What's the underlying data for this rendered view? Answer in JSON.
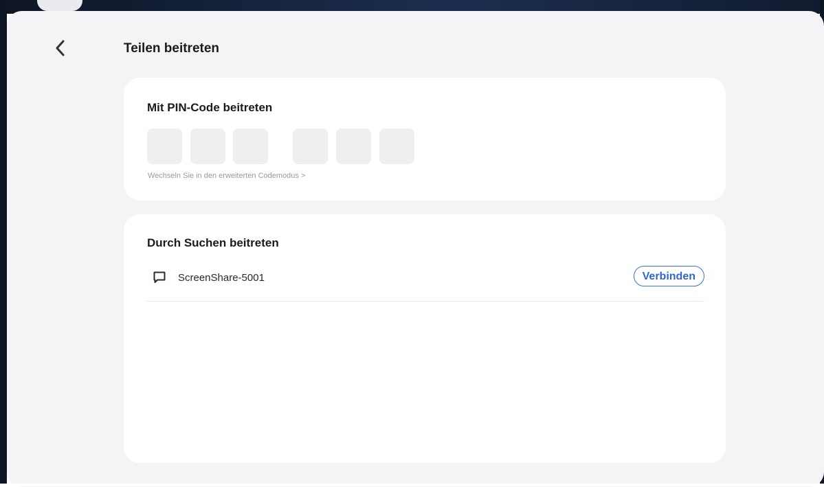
{
  "header": {
    "title": "Teilen beitreten",
    "back_icon": "chevron-left-icon"
  },
  "pin_section": {
    "title": "Mit PIN-Code beitreten",
    "digits": [
      "",
      "",
      "",
      "",
      "",
      ""
    ],
    "advanced_mode_link": "Wechseln Sie in den erweiterten Codemodus >"
  },
  "search_section": {
    "title": "Durch Suchen beitreten",
    "devices": [
      {
        "icon": "screen-share-icon",
        "name": "ScreenShare-5001",
        "action_label": "Verbinden"
      }
    ]
  },
  "colors": {
    "accent": "#2f65d3",
    "sheet_background": "#f4f4f6",
    "card_background": "#ffffff",
    "pin_box": "#efeff1"
  }
}
